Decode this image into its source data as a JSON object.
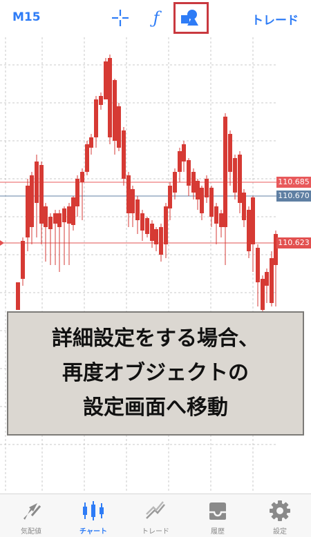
{
  "header": {
    "timeframe": "M15",
    "crosshair_icon": "crosshair-icon",
    "function_icon": "function-icon",
    "function_glyph": "ƒ",
    "objects_icon": "objects-icon",
    "trade_label": "トレード"
  },
  "chart": {
    "price_labels": {
      "upper": "110.685",
      "current": "110.670",
      "lower": "110.623"
    },
    "colors": {
      "up": "#3cae3c",
      "down": "#d63a34",
      "upper_line": "#e8595b",
      "current_line": "#5f7fa3",
      "lower_line": "#e2504f"
    }
  },
  "callout": {
    "line1": "詳細設定をする場合、",
    "line2": "再度オブジェクトの",
    "line3": "設定画面へ移動"
  },
  "tabs": [
    {
      "label": "気配値",
      "icon": "quotes-icon"
    },
    {
      "label": "チャート",
      "icon": "chart-icon"
    },
    {
      "label": "トレード",
      "icon": "trade-icon"
    },
    {
      "label": "履歴",
      "icon": "history-icon"
    },
    {
      "label": "設定",
      "icon": "settings-icon"
    }
  ]
}
